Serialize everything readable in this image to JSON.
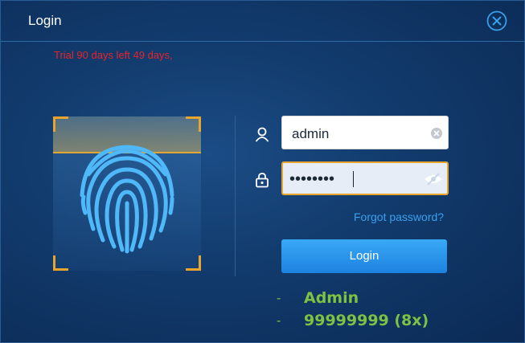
{
  "window": {
    "title": "Login"
  },
  "trial_notice": "Trial 90 days left 49 days,",
  "username": {
    "value": "admin"
  },
  "password": {
    "masked_value": "••••••••"
  },
  "forgot_password_label": "Forgot password?",
  "login_button_label": "Login",
  "notes": [
    {
      "dash": "-",
      "text": "Admin"
    },
    {
      "dash": "-",
      "text": "99999999 (8x)"
    }
  ],
  "icons": {
    "close": "close-circle-icon",
    "user": "user-icon",
    "lock": "lock-icon",
    "clear": "clear-icon",
    "visibility": "eye-off-icon",
    "fingerprint": "fingerprint-icon"
  },
  "colors": {
    "accent": "#1d82e0",
    "trial_text": "#e8232c",
    "link": "#3aa0f0",
    "scan_frame": "#e8a52e",
    "note_text": "#7dc242"
  }
}
